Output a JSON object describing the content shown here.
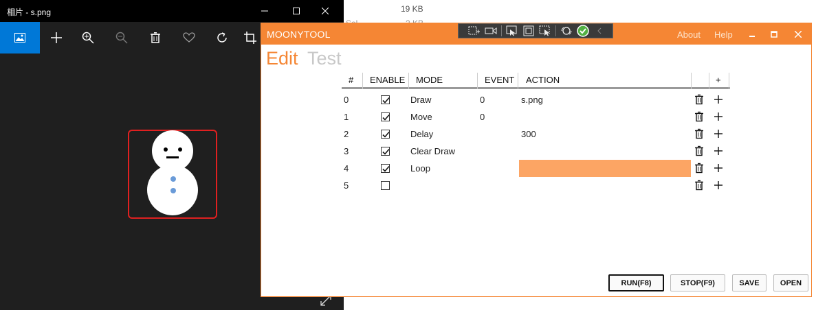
{
  "background": {
    "size_text": "19 KB",
    "size_text2": "2 KB",
    "partial_name": "Sel"
  },
  "photos": {
    "title": "相片 - s.png",
    "toolbar_icons": [
      "image-icon",
      "plus-icon",
      "zoom-in-icon",
      "zoom-out-icon",
      "trash-icon",
      "heart-icon",
      "rotate-icon",
      "crop-icon"
    ],
    "accent": "#0078d7"
  },
  "moonytool": {
    "title": "MOONYTOOL",
    "links": {
      "about": "About",
      "help": "Help"
    },
    "tabs": {
      "edit": "Edit",
      "test": "Test"
    },
    "accent": "#f58634",
    "highlight": "#fca564",
    "table": {
      "headers": {
        "num": "#",
        "enable": "ENABLE",
        "mode": "MODE",
        "event": "EVENT",
        "action": "ACTION",
        "add": "+"
      },
      "rows": [
        {
          "num": "0",
          "enabled": true,
          "mode": "Draw",
          "event": "0",
          "action": "s.png"
        },
        {
          "num": "1",
          "enabled": true,
          "mode": "Move",
          "event": "0",
          "action": ""
        },
        {
          "num": "2",
          "enabled": true,
          "mode": "Delay",
          "event": "",
          "action": "300"
        },
        {
          "num": "3",
          "enabled": true,
          "mode": "Clear Draw",
          "event": "",
          "action": ""
        },
        {
          "num": "4",
          "enabled": true,
          "mode": "Loop",
          "event": "",
          "action": "",
          "action_highlighted": true
        },
        {
          "num": "5",
          "enabled": false,
          "mode": "",
          "event": "",
          "action": ""
        }
      ]
    },
    "buttons": {
      "run": "RUN(F8)",
      "stop": "STOP(F9)",
      "save": "SAVE",
      "open": "OPEN"
    }
  }
}
